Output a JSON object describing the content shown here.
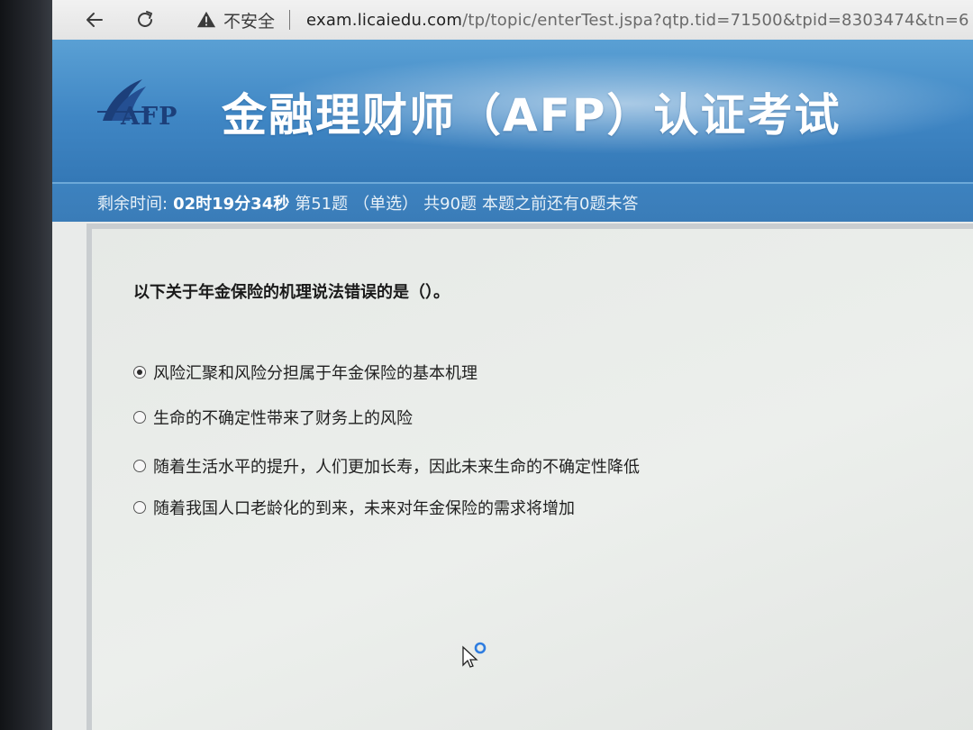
{
  "browser": {
    "security_text": "不安全",
    "url_host": "exam.licaiedu.com",
    "url_path": "/tp/topic/enterTest.jspa?qtp.tid=71500&tpid=8303474&tn=6"
  },
  "header": {
    "logo_text": "AFP",
    "title": "金融理财师（AFP）认证考试"
  },
  "status": {
    "remaining_label": "剩余时间:",
    "remaining_time": "02时19分34秒",
    "question_no": "第51题",
    "question_type": "（单选）",
    "total": "共90题",
    "unanswered_note": "本题之前还有0题未答"
  },
  "question": {
    "text": "以下关于年金保险的机理说法错误的是（）。",
    "options": [
      {
        "label": "风险汇聚和风险分担属于年金保险的基本机理",
        "selected": true
      },
      {
        "label": "生命的不确定性带来了财务上的风险",
        "selected": false
      },
      {
        "label": "随着生活水平的提升，人们更加长寿，因此未来生命的不确定性降低",
        "selected": false
      },
      {
        "label": "随着我国人口老龄化的到来，未来对年金保险的需求将增加",
        "selected": false
      }
    ]
  },
  "colors": {
    "header_blue": "#3f86c4",
    "status_blue": "#3a7cb8",
    "logo_navy": "#1c3f7a"
  }
}
